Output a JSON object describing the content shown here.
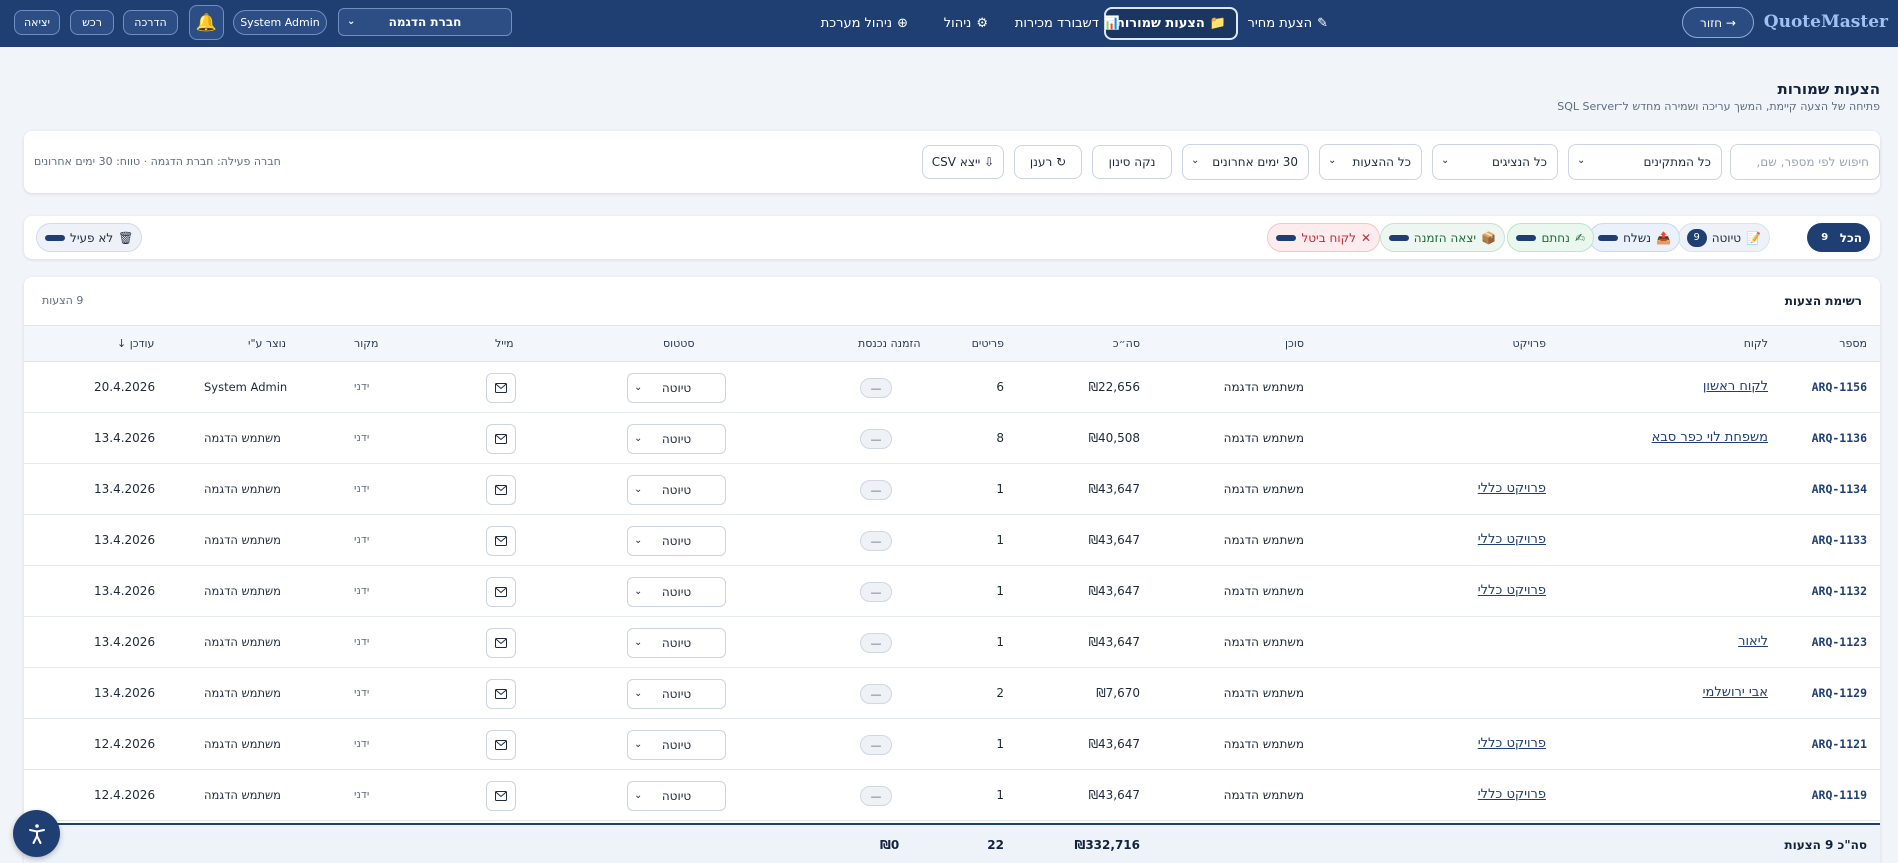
{
  "header": {
    "logo": "QuoteMaster",
    "back_label": "→ חזור",
    "nav": [
      {
        "icon": "pencil-icon",
        "glyph": "✎",
        "label": "הצעת מחיר"
      },
      {
        "icon": "folder-icon",
        "glyph": "📁",
        "label": "הצעות שמורות",
        "active": true
      },
      {
        "icon": "chart-icon",
        "glyph": "📊",
        "label": "דשבורד מכירות"
      },
      {
        "icon": "gear-icon",
        "glyph": "⚙",
        "label": "ניהול"
      },
      {
        "icon": "binoculars-icon",
        "glyph": "⊕",
        "label": "ניהול מערכת"
      }
    ],
    "company": "חברת הדגמה",
    "user": "System Admin",
    "guide_label": "הדרכה",
    "purchase_label": "רכש",
    "logout_label": "יציאה"
  },
  "page": {
    "title": "הצעות שמורות",
    "subtitle": "פתיחה של הצעה קיימת, המשך עריכה ושמירה מחדש ל־SQL Server"
  },
  "filters": {
    "search_placeholder": "חיפוש לפי מספר, שם,",
    "installers": "כל המתקינים",
    "agents": "כל הנציגים",
    "quotes": "כל ההצעות",
    "range": "30 ימים אחרונים",
    "clear_label": "נקה סינון",
    "refresh_label": "↻ רענן",
    "export_label": "⇩ ייצא CSV",
    "active_info": "חברה פעילה: חברת הדגמה · טווח: 30 ימים אחרונים"
  },
  "status_tabs": {
    "all": {
      "label": "הכל",
      "count": "9"
    },
    "draft": {
      "label": "טיוטה",
      "count": "9",
      "glyph": "📝"
    },
    "sent": {
      "label": "נשלח",
      "glyph": "📤"
    },
    "given": {
      "label": "נחתם",
      "glyph": "✍"
    },
    "order": {
      "label": "יצאה הזמנה",
      "glyph": "📦"
    },
    "cancel": {
      "label": "לקוח ביטל",
      "glyph": "✕"
    },
    "inactive": {
      "label": "לא פעיל",
      "glyph": "🗑"
    }
  },
  "table": {
    "title": "רשימת הצעות",
    "count_label": "9 הצעות",
    "columns": {
      "num": "מספר",
      "client": "לקוח",
      "project": "פרויקט",
      "agent": "סוכן",
      "total": "סה״כ",
      "items": "פריטים",
      "order": "הזמנה נכנסת",
      "status": "סטטוס",
      "mail": "מייל",
      "source": "מקור",
      "creator": "נוצר ע\"י",
      "updated": "עודכן ↓"
    },
    "rows": [
      {
        "num": "ARQ-1156",
        "client": "לקוח ראשון",
        "project": "",
        "agent": "משתמש הדגמה",
        "total": "₪22,656",
        "items": "6",
        "order": "—",
        "status": "טיוטה",
        "source": "ידני",
        "creator": "System Admin",
        "updated": "20.4.2026"
      },
      {
        "num": "ARQ-1136",
        "client": "משפחת לוי כפר סבא",
        "project": "",
        "agent": "משתמש הדגמה",
        "total": "₪40,508",
        "items": "8",
        "order": "—",
        "status": "טיוטה",
        "source": "ידני",
        "creator": "משתמש הדגמה",
        "updated": "13.4.2026"
      },
      {
        "num": "ARQ-1134",
        "client": "",
        "project": "פרויקט כללי",
        "agent": "משתמש הדגמה",
        "total": "₪43,647",
        "items": "1",
        "order": "—",
        "status": "טיוטה",
        "source": "ידני",
        "creator": "משתמש הדגמה",
        "updated": "13.4.2026"
      },
      {
        "num": "ARQ-1133",
        "client": "",
        "project": "פרויקט כללי",
        "agent": "משתמש הדגמה",
        "total": "₪43,647",
        "items": "1",
        "order": "—",
        "status": "טיוטה",
        "source": "ידני",
        "creator": "משתמש הדגמה",
        "updated": "13.4.2026"
      },
      {
        "num": "ARQ-1132",
        "client": "",
        "project": "פרויקט כללי",
        "agent": "משתמש הדגמה",
        "total": "₪43,647",
        "items": "1",
        "order": "—",
        "status": "טיוטה",
        "source": "ידני",
        "creator": "משתמש הדגמה",
        "updated": "13.4.2026"
      },
      {
        "num": "ARQ-1123",
        "client": "ליאור",
        "project": "",
        "agent": "משתמש הדגמה",
        "total": "₪43,647",
        "items": "1",
        "order": "—",
        "status": "טיוטה",
        "source": "ידני",
        "creator": "משתמש הדגמה",
        "updated": "13.4.2026"
      },
      {
        "num": "ARQ-1129",
        "client": "אבי ירושלמי",
        "project": "",
        "agent": "משתמש הדגמה",
        "total": "₪7,670",
        "items": "2",
        "order": "—",
        "status": "טיוטה",
        "source": "ידני",
        "creator": "משתמש הדגמה",
        "updated": "13.4.2026"
      },
      {
        "num": "ARQ-1121",
        "client": "",
        "project": "פרויקט כללי",
        "agent": "משתמש הדגמה",
        "total": "₪43,647",
        "items": "1",
        "order": "—",
        "status": "טיוטה",
        "source": "ידני",
        "creator": "משתמש הדגמה",
        "updated": "12.4.2026"
      },
      {
        "num": "ARQ-1119",
        "client": "",
        "project": "פרויקט כללי",
        "agent": "משתמש הדגמה",
        "total": "₪43,647",
        "items": "1",
        "order": "—",
        "status": "טיוטה",
        "source": "ידני",
        "creator": "משתמש הדגמה",
        "updated": "12.4.2026"
      }
    ],
    "footer": {
      "label": "סה\"כ 9 הצעות",
      "total": "₪332,716",
      "items": "22",
      "order": "₪0"
    }
  },
  "colors": {
    "brand": "#1f3f73",
    "logo": "#9fc0f2",
    "cancel": "#c22b3a",
    "success": "#1d6b35"
  }
}
